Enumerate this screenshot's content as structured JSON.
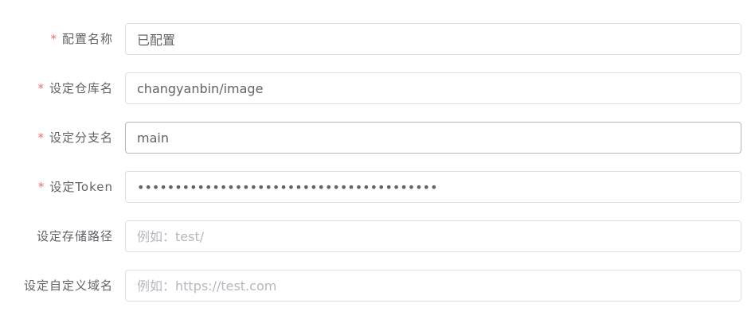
{
  "form": {
    "required_mark": "*",
    "fields": [
      {
        "label": "配置名称",
        "required": true,
        "value": "已配置",
        "placeholder": ""
      },
      {
        "label": "设定仓库名",
        "required": true,
        "value": "changyanbin/image",
        "placeholder": ""
      },
      {
        "label": "设定分支名",
        "required": true,
        "value": "main",
        "placeholder": ""
      },
      {
        "label": "设定Token",
        "required": true,
        "value": "●●●●●●●●●●●●●●●●●●●●●●●●●●●●●●●●●●●●●●●●",
        "placeholder": ""
      },
      {
        "label": "设定存储路径",
        "required": false,
        "value": "",
        "placeholder": "例如：test/"
      },
      {
        "label": "设定自定义域名",
        "required": false,
        "value": "",
        "placeholder": "例如：https://test.com"
      }
    ]
  }
}
